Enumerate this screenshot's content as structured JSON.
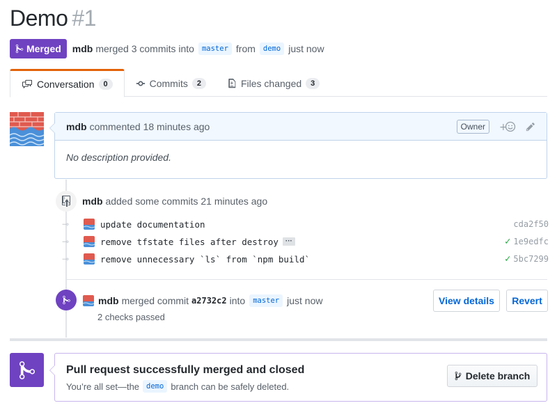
{
  "header": {
    "title": "Demo",
    "number": "#1",
    "state_label": "Merged",
    "author": "mdb",
    "merge_summary": "merged 3 commits into",
    "base_branch": "master",
    "from_word": "from",
    "head_branch": "demo",
    "time": "just now"
  },
  "tabs": [
    {
      "label": "Conversation",
      "count": "0"
    },
    {
      "label": "Commits",
      "count": "2"
    },
    {
      "label": "Files changed",
      "count": "3"
    }
  ],
  "comment": {
    "author": "mdb",
    "action": "commented 18 minutes ago",
    "role_badge": "Owner",
    "body": "No description provided."
  },
  "commits_event": {
    "author": "mdb",
    "text": "added some commits 21 minutes ago",
    "commits": [
      {
        "message": "update documentation",
        "sha": "cda2f50",
        "has_check": false,
        "has_ellipsis": false
      },
      {
        "message": "remove tfstate files after destroy",
        "sha": "1e9edfc",
        "has_check": true,
        "has_ellipsis": true,
        "ellipsis": "···"
      },
      {
        "message": "remove unnecessary `ls` from `npm build`",
        "sha": "5bc7299",
        "has_check": true,
        "has_ellipsis": false
      }
    ]
  },
  "merge_event": {
    "author": "mdb",
    "action": "merged commit",
    "commit_sha": "a2732c2",
    "into_word": "into",
    "branch": "master",
    "time": "just now",
    "checks": "2 checks passed",
    "view_details_label": "View details",
    "revert_label": "Revert"
  },
  "merged_panel": {
    "title": "Pull request successfully merged and closed",
    "sub_prefix": "You’re all set—the",
    "branch": "demo",
    "sub_suffix": "branch can be safely deleted.",
    "delete_label": "Delete branch"
  },
  "colors": {
    "merged_purple": "#6f42c1",
    "link_blue": "#0366d6",
    "success_green": "#28a745",
    "tab_accent": "#e36209"
  }
}
